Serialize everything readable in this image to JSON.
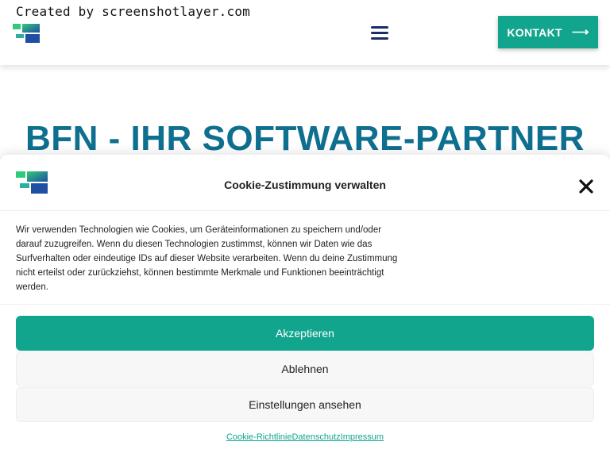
{
  "header": {
    "watermark": "Created by screenshotlayer.com",
    "logo_icon": "bfn-logo-icon",
    "menu_icon": "hamburger-menu-icon",
    "kontakt_label": "KONTAKT",
    "kontakt_icon": "arrow-right-icon"
  },
  "hero": {
    "title": "BFN - IHR SOFTWARE-PARTNER"
  },
  "cookie": {
    "title": "Cookie-Zustimmung verwalten",
    "close_icon": "close-icon",
    "text": "Wir verwenden Technologien wie Cookies, um Geräteinformationen zu speichern und/oder darauf zuzugreifen. Wenn du diesen Technologien zustimmst, können wir Daten wie das Surfverhalten oder eindeutige IDs auf dieser Website verarbeiten. Wenn du deine Zustimmung nicht erteilst oder zurückziehst, können bestimmte Merkmale und Funktionen beeinträchtigt werden.",
    "accept_label": "Akzeptieren",
    "deny_label": "Ablehnen",
    "settings_label": "Einstellungen ansehen",
    "links": [
      "Cookie-Richtlinie",
      "Datenschutz",
      "Impressum"
    ]
  },
  "colors": {
    "accent": "#10a58c",
    "title": "#0f6f8f",
    "logo_green": "#31c97a",
    "logo_blue": "#1f4fa3"
  }
}
